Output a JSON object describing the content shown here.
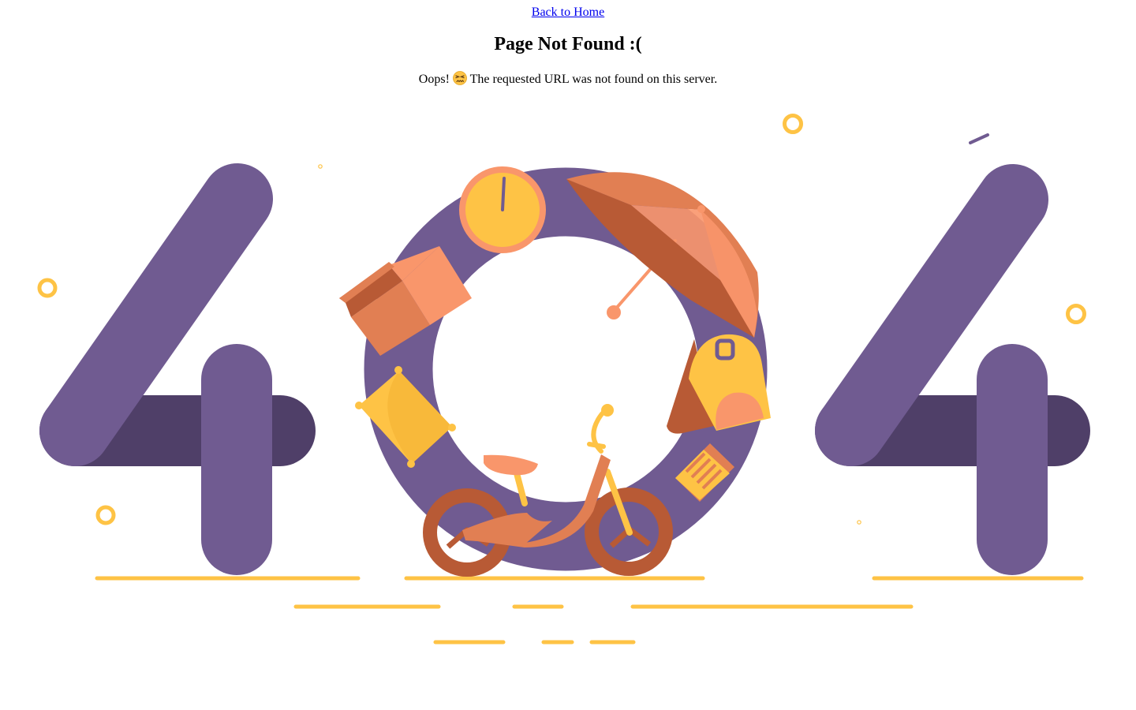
{
  "nav": {
    "back_home_label": "Back to Home"
  },
  "error": {
    "title": "Page Not Found :(",
    "message_prefix": "Oops!",
    "message_emoji_icon": "confounded-face-icon",
    "message_text": "The requested URL was not found on this server."
  },
  "illustration": {
    "digits": [
      "4",
      "0",
      "4"
    ],
    "colors": {
      "purple": "#705b91",
      "dark_purple": "#4f3f68",
      "yellow": "#fec345",
      "orange": "#f9966b",
      "dark_orange": "#e17f53",
      "brown": "#b85a35"
    },
    "objects": [
      "clock-icon",
      "umbrella-icon",
      "box-icon",
      "pillow-icon",
      "backpack-icon",
      "book-icon",
      "balance-bike-icon"
    ]
  }
}
